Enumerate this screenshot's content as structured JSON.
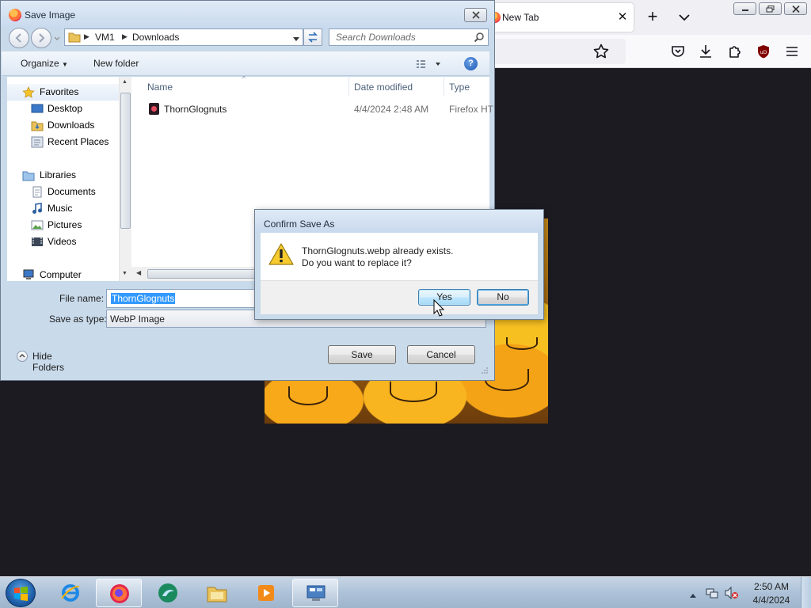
{
  "firefox": {
    "tab": {
      "title": "New Tab"
    }
  },
  "save_dialog": {
    "title": "Save Image",
    "breadcrumb": [
      "VM1",
      "Downloads"
    ],
    "search_placeholder": "Search Downloads",
    "toolbar": {
      "organize": "Organize",
      "new_folder": "New folder"
    },
    "nav": {
      "favorites": "Favorites",
      "favorite_items": [
        "Desktop",
        "Downloads",
        "Recent Places"
      ],
      "libraries": "Libraries",
      "library_items": [
        "Documents",
        "Music",
        "Pictures",
        "Videos"
      ],
      "computer": "Computer"
    },
    "columns": {
      "name": "Name",
      "date_modified": "Date modified",
      "type": "Type"
    },
    "files": [
      {
        "name": "ThornGlognuts",
        "date_modified": "4/4/2024 2:48 AM",
        "type": "Firefox HT"
      }
    ],
    "file_name_label": "File name:",
    "file_name_value": "ThornGlognuts",
    "save_as_type_label": "Save as type:",
    "save_as_type_value": "WebP Image",
    "hide_folders": "Hide Folders",
    "save_label": "Save",
    "cancel_label": "Cancel"
  },
  "confirm_dialog": {
    "title": "Confirm Save As",
    "message_line1": "ThornGlognuts.webp already exists.",
    "message_line2": "Do you want to replace it?",
    "yes_label": "Yes",
    "no_label": "No"
  },
  "taskbar": {
    "apps": [
      "internet-explorer-icon",
      "firefox-icon",
      "app-icon",
      "file-explorer-icon",
      "media-player-icon",
      "control-panel-icon"
    ],
    "clock_time": "2:50 AM",
    "clock_date": "4/4/2024"
  }
}
